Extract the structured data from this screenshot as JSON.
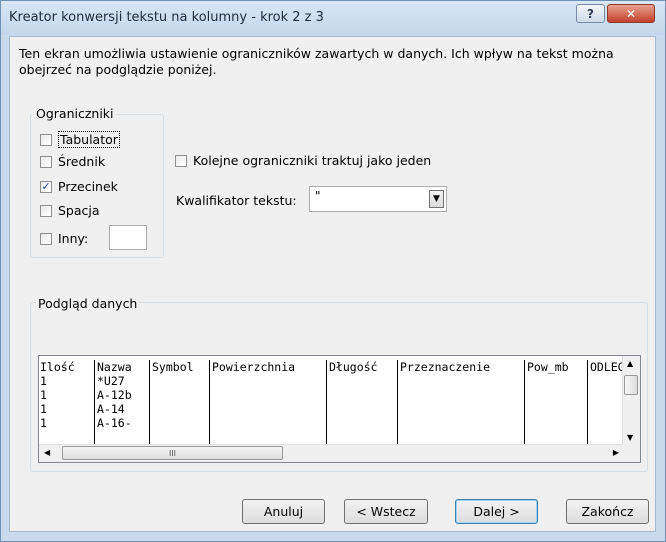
{
  "window": {
    "title": "Kreator konwersji tekstu na kolumny - krok 2 z 3",
    "help_label": "?",
    "close_label": "✕"
  },
  "intro": {
    "text": "Ten ekran umożliwia ustawienie ograniczników zawartych w danych. Ich wpływ na tekst można obejrzeć na podglądzie poniżej."
  },
  "delimiters": {
    "legend": "Ograniczniki",
    "items": [
      {
        "label": "Tabulator",
        "checked": false
      },
      {
        "label": "Średnik",
        "checked": false
      },
      {
        "label": "Przecinek",
        "checked": true
      },
      {
        "label": "Spacja",
        "checked": false
      },
      {
        "label": "Inny:",
        "checked": false
      }
    ],
    "other_value": ""
  },
  "options": {
    "consecutive_label": "Kolejne ograniczniki traktuj jako jeden",
    "consecutive_checked": false,
    "qualifier_label": "Kwalifikator tekstu:",
    "qualifier_value": "\""
  },
  "preview": {
    "legend": "Podgląd danych",
    "columns": [
      {
        "header": "Ilość",
        "cells": [
          "1",
          "1",
          "1",
          "1"
        ]
      },
      {
        "header": "Nazwa",
        "cells": [
          "*U27",
          "A-12b",
          "A-14",
          "A-16-"
        ]
      },
      {
        "header": "Symbol",
        "cells": [
          "",
          "",
          "",
          ""
        ]
      },
      {
        "header": "Powierzchnia",
        "cells": [
          "",
          "",
          "",
          ""
        ]
      },
      {
        "header": "Długość",
        "cells": [
          "",
          "",
          "",
          ""
        ]
      },
      {
        "header": "Przeznaczenie",
        "cells": [
          "",
          "",
          "",
          ""
        ]
      },
      {
        "header": "Pow_mb",
        "cells": [
          "",
          "",
          "",
          ""
        ]
      },
      {
        "header": "ODLEG",
        "cells": [
          "",
          "",
          "",
          ""
        ]
      }
    ],
    "hscroll_grip": "III"
  },
  "buttons": {
    "cancel": "Anuluj",
    "back": "< Wstecz",
    "next": "Dalej >",
    "finish": "Zakończ"
  },
  "icons": {
    "check": "check-icon",
    "dropdown": "chevron-down-icon",
    "scroll_up": "arrow-up-icon",
    "scroll_down": "arrow-down-icon",
    "scroll_left": "arrow-left-icon",
    "scroll_right": "arrow-right-icon"
  }
}
